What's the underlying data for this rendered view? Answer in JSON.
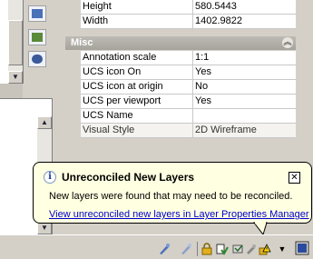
{
  "properties": {
    "top_rows": [
      {
        "key": "Height",
        "value": "580.5443"
      },
      {
        "key": "Width",
        "value": "1402.9822"
      }
    ],
    "misc_section": {
      "title": "Misc",
      "rows": [
        {
          "key": "Annotation scale",
          "value": "1:1"
        },
        {
          "key": "UCS icon On",
          "value": "Yes"
        },
        {
          "key": "UCS icon at origin",
          "value": "No"
        },
        {
          "key": "UCS per viewport",
          "value": "Yes"
        },
        {
          "key": "UCS Name",
          "value": ""
        },
        {
          "key": "Visual Style",
          "value": "2D Wireframe"
        }
      ]
    }
  },
  "notification": {
    "title": "Unreconciled New Layers",
    "message": "New layers were found that may need to be reconciled.",
    "link": "View unreconciled new layers in Layer Properties Manager"
  },
  "colors": {
    "balloon_bg": "#ffffe1",
    "link": "#0000cc",
    "panel": "#d4d0c8"
  }
}
